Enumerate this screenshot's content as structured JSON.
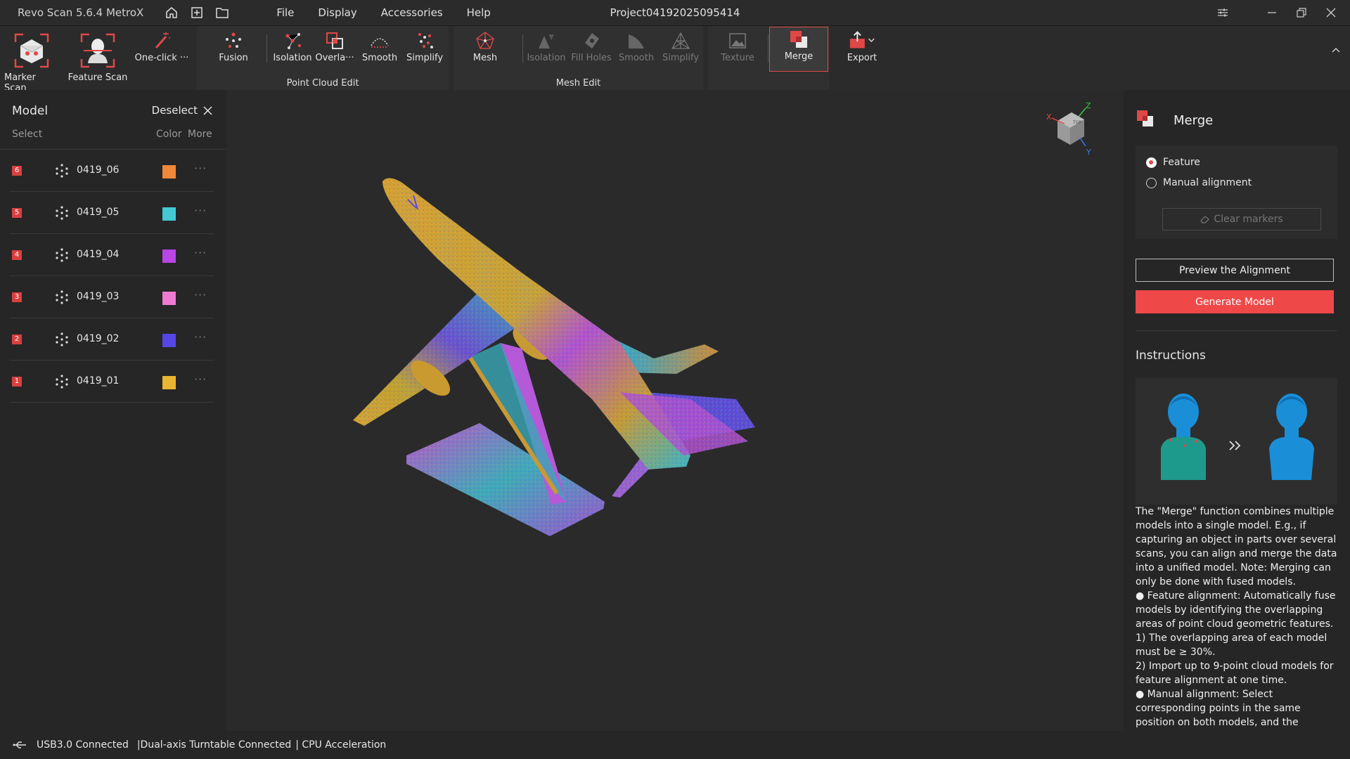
{
  "titlebar": {
    "app_title": "Revo Scan 5.6.4 MetroX",
    "menu": [
      "File",
      "Display",
      "Accessories",
      "Help"
    ],
    "project": "Project04192025095414"
  },
  "toolbar": {
    "marker_scan": "Marker Scan",
    "feature_scan": "Feature Scan",
    "one_click": "One-click ···",
    "fusion": "Fusion",
    "isolation": "Isolation",
    "overlap": "Overla···",
    "smooth": "Smooth",
    "simplify": "Simplify",
    "point_cloud_edit": "Point Cloud Edit",
    "mesh": "Mesh",
    "mesh_isolation": "Isolation",
    "fill_holes": "Fill Holes",
    "mesh_smooth": "Smooth",
    "mesh_simplify": "Simplify",
    "mesh_edit": "Mesh Edit",
    "texture": "Texture",
    "merge": "Merge",
    "export": "Export"
  },
  "left_panel": {
    "title": "Model",
    "deselect": "Deselect",
    "col_select": "Select",
    "col_color": "Color",
    "col_more": "More",
    "models": [
      {
        "index": "6",
        "name": "0419_06",
        "color": "#f0883a"
      },
      {
        "index": "5",
        "name": "0419_05",
        "color": "#44c8d4"
      },
      {
        "index": "4",
        "name": "0419_04",
        "color": "#b845e6"
      },
      {
        "index": "3",
        "name": "0419_03",
        "color": "#ef7ad2"
      },
      {
        "index": "2",
        "name": "0419_02",
        "color": "#5646e6"
      },
      {
        "index": "1",
        "name": "0419_01",
        "color": "#e8b531"
      }
    ]
  },
  "viewport": {
    "axis_labels": {
      "x": "X",
      "y": "Y",
      "z": "Z"
    }
  },
  "right_panel": {
    "title": "Merge",
    "option_feature": "Feature",
    "option_manual": "Manual alignment",
    "selected_option": "Feature",
    "clear_markers": "Clear markers",
    "preview": "Preview the Alignment",
    "generate": "Generate Model",
    "instructions_title": "Instructions",
    "instructions_text": "The \"Merge\" function combines multiple models into a single model. E.g., if capturing an object in parts over several scans, you can align and merge the data into a unified model. Note: Merging can only be done with fused models.\n● Feature alignment: Automatically fuse models by identifying the overlapping areas of point cloud geometric features.\n1) The overlapping area of each model must be ≥ 30%.\n2) Import up to 9-point cloud models for feature alignment at one time.\n● Manual alignment: Select corresponding points in the same position on both models, and the"
  },
  "statusbar": {
    "usb": "USB3.0 Connected",
    "turntable": "|Dual-axis Turntable Connected",
    "cpu": "| CPU Acceleration"
  },
  "colors": {
    "accent": "#ee4848",
    "bg": "#1e1e1e",
    "panel": "#262626"
  }
}
